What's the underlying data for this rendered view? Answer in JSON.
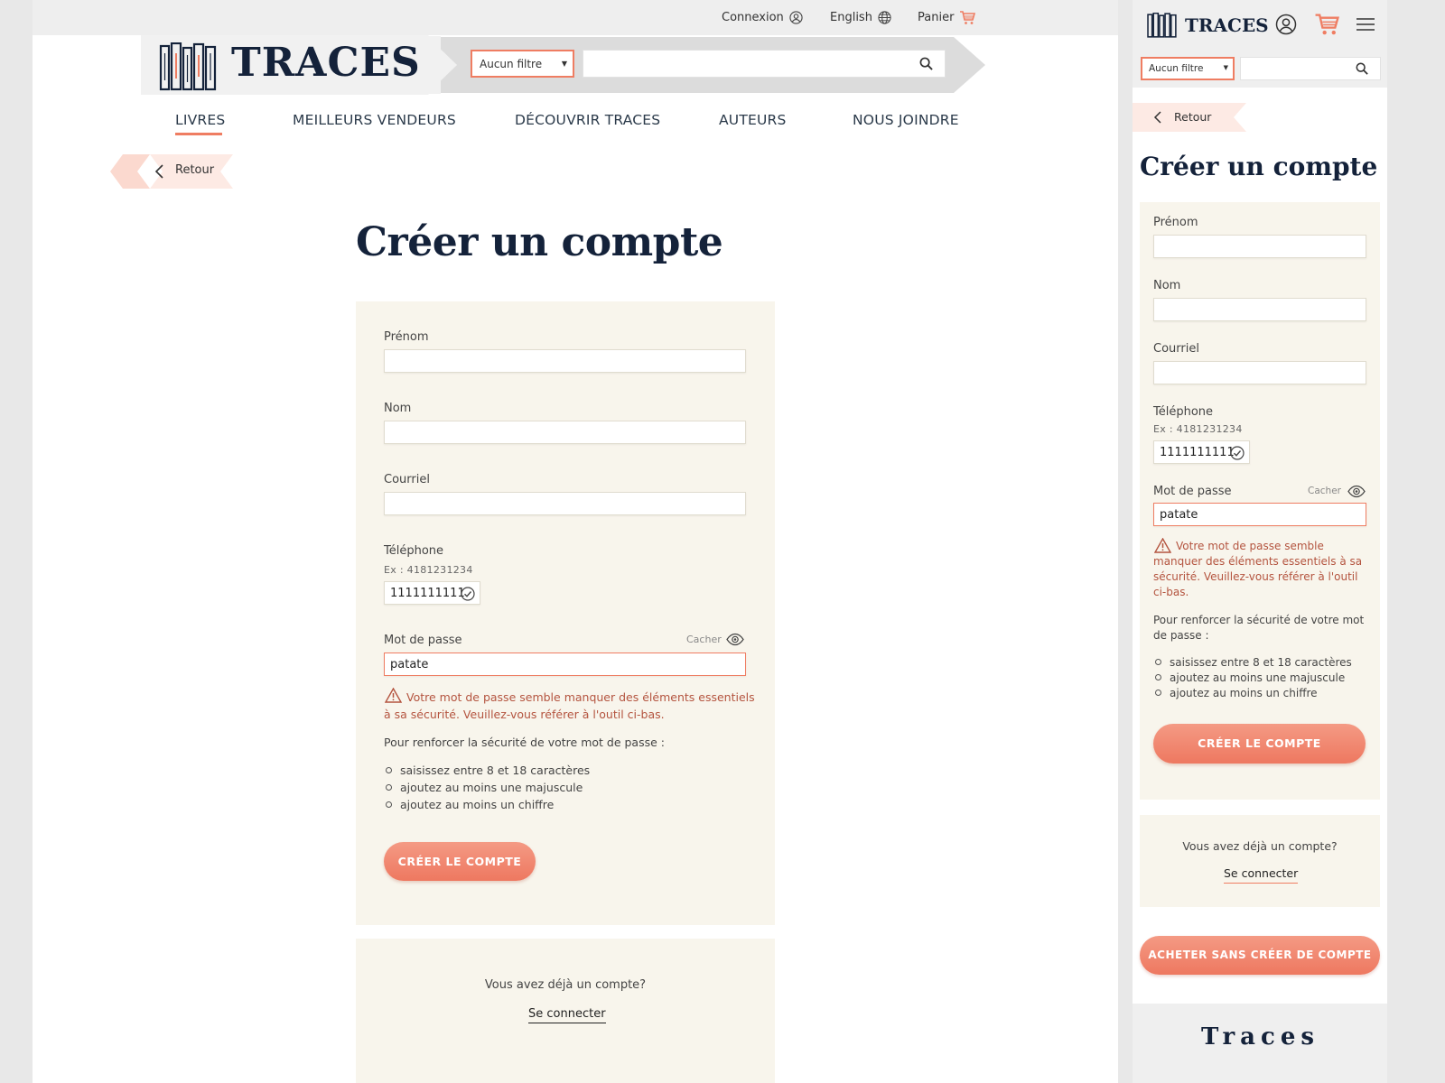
{
  "colors": {
    "accent": "#ef7d62",
    "navy": "#14223a",
    "card": "#f8f5ec",
    "error": "#b4543f"
  },
  "brand": {
    "name": "TRACES"
  },
  "utility": {
    "login": "Connexion",
    "language": "English",
    "cart": "Panier"
  },
  "search": {
    "filter_selected": "Aucun filtre",
    "placeholder": ""
  },
  "nav": [
    {
      "label": "LIVRES",
      "active": true
    },
    {
      "label": "MEILLEURS VENDEURS"
    },
    {
      "label": "DÉCOUVRIR TRACES"
    },
    {
      "label": "AUTEURS"
    },
    {
      "label": "NOUS JOINDRE"
    }
  ],
  "back": {
    "label": "Retour"
  },
  "page": {
    "title": "Créer un compte"
  },
  "form": {
    "first_name": {
      "label": "Prénom",
      "value": ""
    },
    "last_name": {
      "label": "Nom",
      "value": ""
    },
    "email": {
      "label": "Courriel",
      "value": ""
    },
    "phone": {
      "label": "Téléphone",
      "hint": "Ex : 4181231234",
      "value": "1111111111"
    },
    "password": {
      "label": "Mot de passe",
      "toggle": "Cacher",
      "value": "patate"
    },
    "error_line1": "Votre mot de passe semble manquer des éléments essentiels",
    "error_line2": "à sa sécurité. Veuillez-vous référer à l'outil ci-bas.",
    "tips_intro": "Pour renforcer la sécurité de votre mot de passe :",
    "tips": [
      "saisissez entre 8 et 18 caractères",
      "ajoutez au moins une majuscule",
      "ajoutez au moins un chiffre"
    ],
    "submit": "CRÉER LE COMPTE"
  },
  "login": {
    "question": "Vous avez déjà un compte?",
    "link": "Se connecter"
  },
  "mobile": {
    "error_lines": [
      "Votre mot de passe semble",
      "manquer des éléments essentiels à sa",
      "sécurité. Veuillez-vous référer à l'outil",
      "ci-bas."
    ],
    "tips_intro_lines": [
      "Pour renforcer la sécurité de votre mot",
      "de passe :"
    ],
    "guest_button": "ACHETER SANS CRÉER DE COMPTE",
    "footer_logo": "Traces"
  }
}
